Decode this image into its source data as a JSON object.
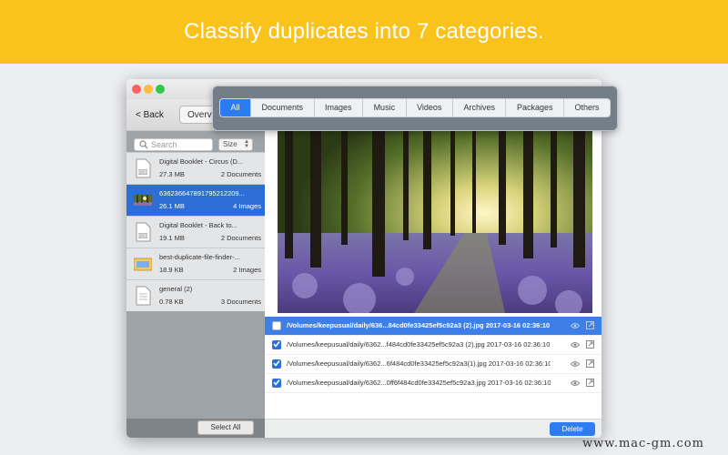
{
  "banner": {
    "title": "Classify duplicates into 7 categories."
  },
  "window": {
    "back_label": "< Back",
    "overview_label": "Overvie"
  },
  "categories": {
    "tabs": [
      "All",
      "Documents",
      "Images",
      "Music",
      "Videos",
      "Archives",
      "Packages",
      "Others"
    ],
    "active": "All"
  },
  "sidebar": {
    "search_placeholder": "Search",
    "sort_label": "Size",
    "files": [
      {
        "name": "Digital Booklet - Circus (D...",
        "size": "27.3 MB",
        "count": "2 Documents",
        "icon": "pdf-icon"
      },
      {
        "name": "636236647891795212209...",
        "size": "26.1 MB",
        "count": "4 Images",
        "icon": "image-icon",
        "selected": true
      },
      {
        "name": "Digital Booklet - Back to...",
        "size": "19.1 MB",
        "count": "2 Documents",
        "icon": "pdf-icon"
      },
      {
        "name": "best-duplicate-file-finder-...",
        "size": "18.9 KB",
        "count": "2 Images",
        "icon": "image-icon"
      },
      {
        "name": "general (2)",
        "size": "0.78 KB",
        "count": "3 Documents",
        "icon": "document-icon"
      }
    ],
    "select_all_label": "Select All"
  },
  "duplicates": [
    {
      "path": "/Volumes/keepusual/daily/636...84cd0fe33425ef5c92a3  (2).jpg  2017-03-16 02:36:10",
      "checked": false,
      "selected": true
    },
    {
      "path": "/Volumes/keepusual/daily/6362...f484cd0fe33425ef5c92a3 (2).jpg  2017-03-16 02:36:10",
      "checked": true,
      "selected": false
    },
    {
      "path": "/Volumes/keepusual/daily/6362...6f484cd0fe33425ef5c92a3(1).jpg  2017-03-16 02:36:10",
      "checked": true,
      "selected": false
    },
    {
      "path": "/Volumes/keepusual/daily/6362...0ff6f484cd0fe33425ef5c92a3.jpg  2017-03-16 02:36:10",
      "checked": true,
      "selected": false
    }
  ],
  "delete_label": "Delete",
  "watermark": "www.mac-gm.com",
  "colors": {
    "banner": "#f9c31c",
    "accent": "#2b7cf0",
    "sidebar": "#9ea3a8"
  }
}
